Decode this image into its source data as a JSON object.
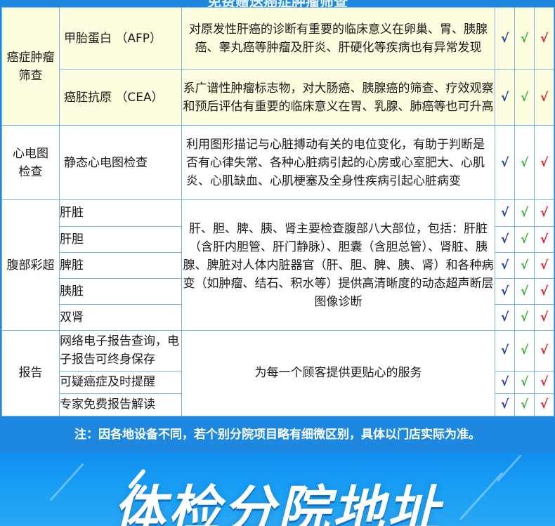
{
  "header": {
    "title": "免费赠送癌症肿瘤筛查"
  },
  "check_marks": {
    "blue": "√",
    "green": "√",
    "red": "√"
  },
  "sections": {
    "tumor": {
      "category": "癌症肿瘤筛查",
      "items": [
        {
          "name": "甲胎蛋白 （AFP）",
          "description": "对原发性肝癌的诊断有重要的临床意义在卵巢、胃、胰腺癌、睾丸癌等肿瘤及肝炎、肝硬化等疾病也有异常发现"
        },
        {
          "name": "癌胚抗原 （CEA）",
          "description": "系广谱性肿瘤标志物，对大肠癌、胰腺癌的筛查、疗效观察和预后评估有重要的临床意义在胃、乳腺、肺癌等也可升高"
        }
      ]
    },
    "ecg": {
      "category": "心电图检查",
      "items": [
        {
          "name": "静态心电图检查",
          "description": "利用图形描记与心脏搏动有关的电位变化，有助于判断是否有心律失常、各种心脏病引起的心房或心室肥大、心肌炎、心肌缺血、心肌梗塞及全身性疾病引起心脏病变"
        }
      ]
    },
    "ultrasound": {
      "category": "腹部彩超",
      "items": [
        "肝脏",
        "肝胆",
        "脾脏",
        "胰脏",
        "双肾"
      ],
      "description": "肝、胆、脾、胰、肾主要检查腹部八大部位，包括：肝脏（含肝内胆管、肝门静脉）、胆囊（含胆总管）、肾脏、胰腺、脾脏对人体内脏器官（肝、胆、脾、胰、肾）和各种病变（如肿瘤、结石、积水等）提供高清晰度的动态超声断层图像诊断"
    },
    "report": {
      "category": "报告",
      "items": [
        "网络电子报告查询，电子报告可终身保存",
        "可疑癌症及时提醒",
        "专家免费报告解读"
      ],
      "description": "为每一个顾客提供更贴心的服务"
    }
  },
  "note": "注：因各地设备不同，若个别分院项目略有细微区别，具体以门店实际为准。",
  "banner": {
    "title": "体检分院地址"
  }
}
